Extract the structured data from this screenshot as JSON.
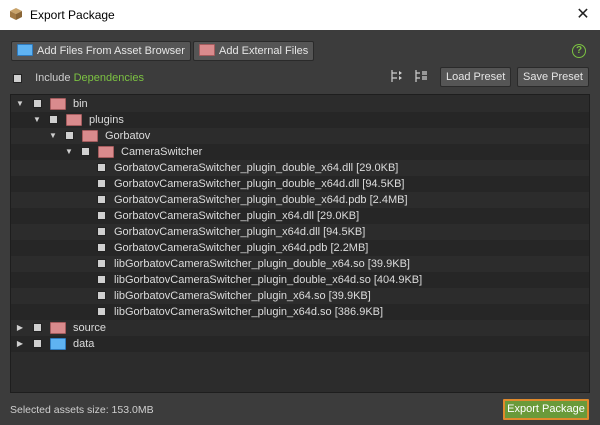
{
  "window": {
    "title": "Export Package",
    "close_glyph": "✕"
  },
  "toolbar": {
    "add_from_browser": "Add Files From Asset Browser",
    "add_external": "Add External Files",
    "help_glyph": "?",
    "include_label": "Include",
    "dependencies_label": "Dependencies",
    "load_preset": "Load Preset",
    "save_preset": "Save Preset"
  },
  "tree": {
    "bin": "bin",
    "plugins": "plugins",
    "gorbatov": "Gorbatov",
    "camera_switcher": "CameraSwitcher",
    "files": [
      "GorbatovCameraSwitcher_plugin_double_x64.dll [29.0KB]",
      "GorbatovCameraSwitcher_plugin_double_x64d.dll [94.5KB]",
      "GorbatovCameraSwitcher_plugin_double_x64d.pdb [2.4MB]",
      "GorbatovCameraSwitcher_plugin_x64.dll [29.0KB]",
      "GorbatovCameraSwitcher_plugin_x64d.dll [94.5KB]",
      "GorbatovCameraSwitcher_plugin_x64d.pdb [2.2MB]",
      "libGorbatovCameraSwitcher_plugin_double_x64.so [39.9KB]",
      "libGorbatovCameraSwitcher_plugin_double_x64d.so [404.9KB]",
      "libGorbatovCameraSwitcher_plugin_x64.so [39.9KB]",
      "libGorbatovCameraSwitcher_plugin_x64d.so [386.9KB]"
    ],
    "source": "source",
    "data": "data"
  },
  "footer": {
    "status": "Selected assets size: 153.0MB",
    "export": "Export Package"
  },
  "colors": {
    "accent_green": "#7cc242",
    "export_border": "#e08a2c",
    "folder_pink": "#d98b8d",
    "folder_blue": "#5fb3f2"
  },
  "icons": {
    "app": "package-box-icon",
    "close": "close-icon",
    "help": "help-circle-icon",
    "expand_all": "expand-all-icon",
    "collapse_all": "collapse-all-icon"
  }
}
